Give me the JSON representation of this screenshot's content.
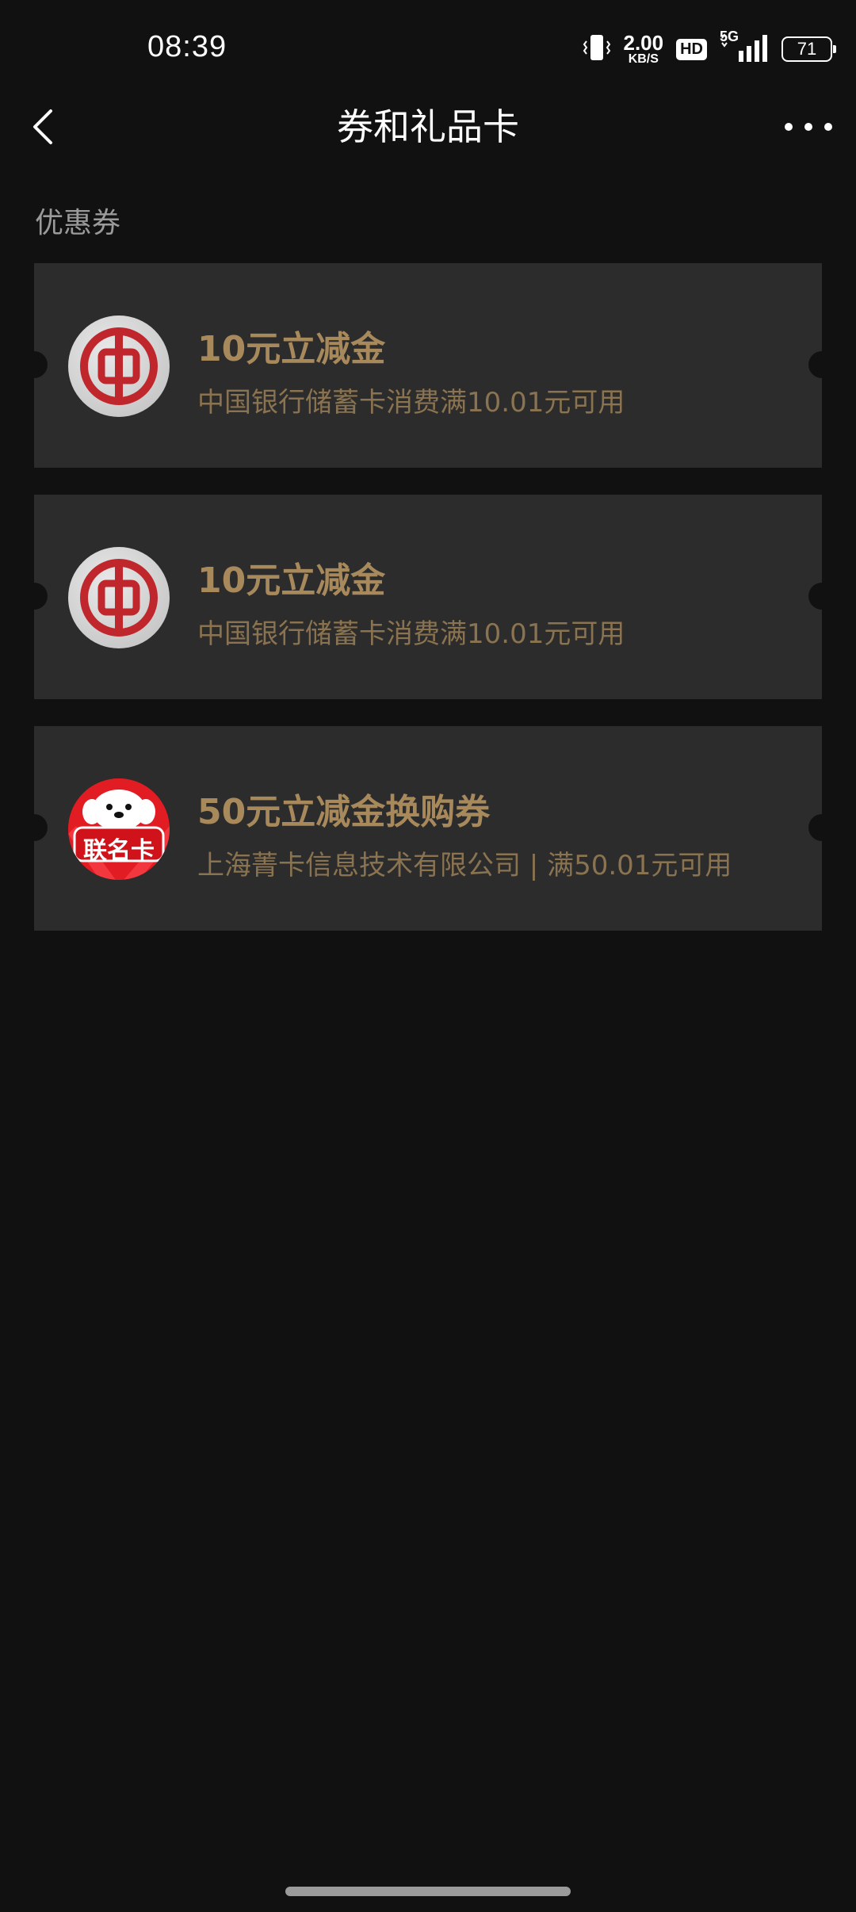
{
  "status_bar": {
    "time": "08:39",
    "speed_value": "2.00",
    "speed_unit": "KB/S",
    "hd": "HD",
    "network": "5G",
    "battery": "71"
  },
  "header": {
    "title": "券和礼品卡"
  },
  "section": {
    "label": "优惠券"
  },
  "coupons": [
    {
      "title": "10元立减金",
      "desc": "中国银行储蓄卡消费满10.01元可用",
      "logo": "bank-of-china-logo"
    },
    {
      "title": "10元立减金",
      "desc": "中国银行储蓄卡消费满10.01元可用",
      "logo": "bank-of-china-logo"
    },
    {
      "title": "50元立减金换购券",
      "desc": "上海菁卡信息技术有限公司 | 满50.01元可用",
      "logo": "jd-co-branded-card-logo",
      "logo_text": "联名卡"
    }
  ],
  "colors": {
    "background": "#111111",
    "card": "#2c2c2c",
    "gold_title": "#a8895b",
    "gold_desc": "#8a7350",
    "boc_red": "#c0272d",
    "jd_red": "#e21c23"
  }
}
